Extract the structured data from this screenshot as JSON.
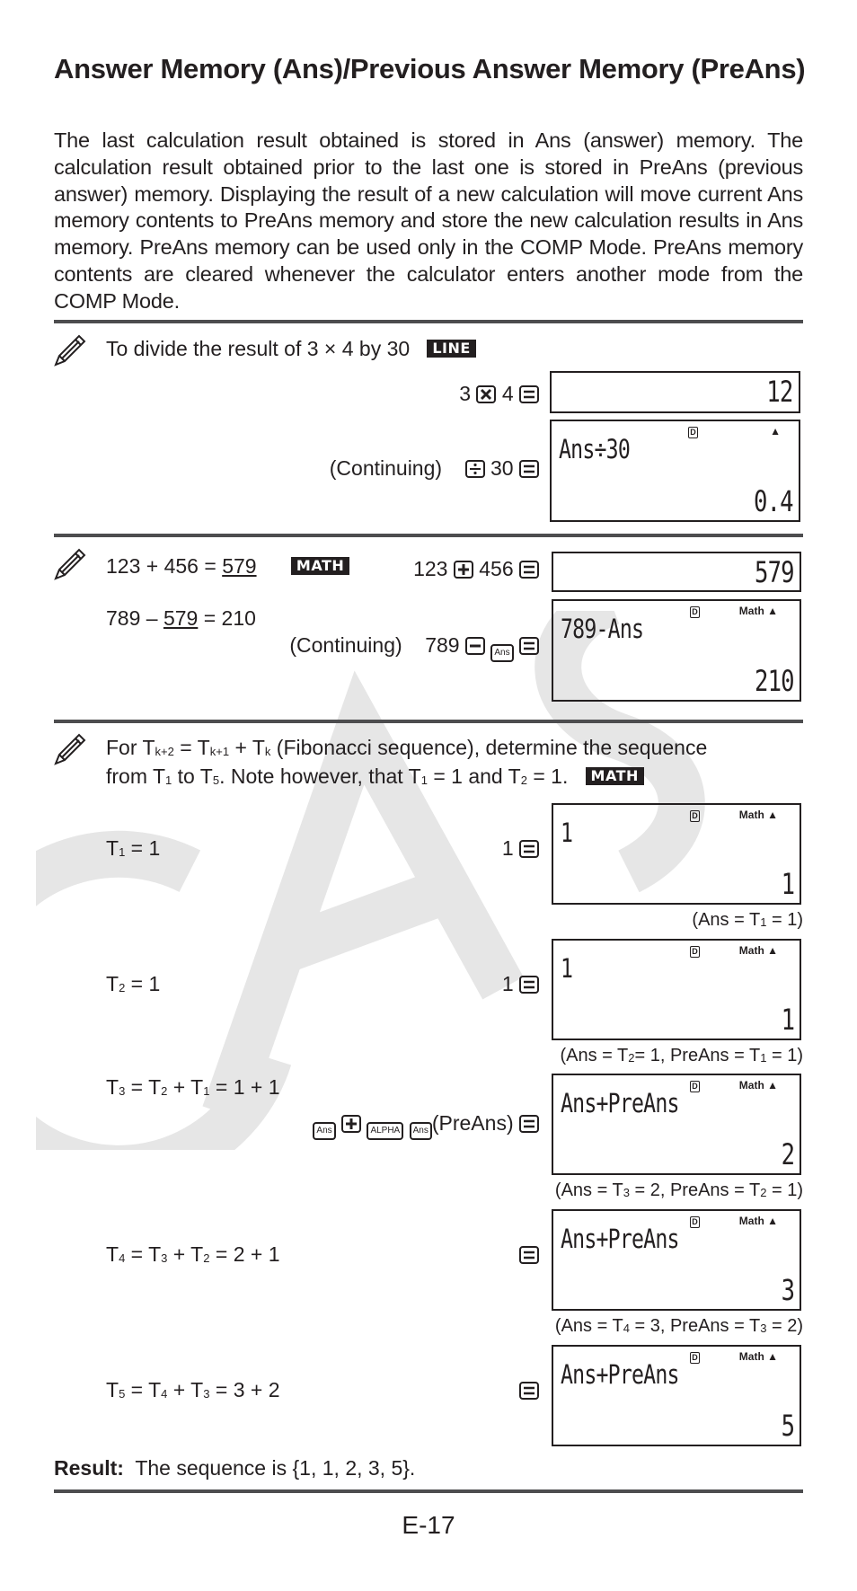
{
  "page": {
    "title": "Answer Memory (Ans)/Previous Answer Memory (PreAns)",
    "intro": "The last calculation result obtained is stored in Ans (answer) memory.  The calculation result obtained prior to the last one is stored in PreAns (previous answer) memory. Displaying the result of a new calculation will move current Ans memory contents to PreAns memory and store the new calculation results in Ans memory. PreAns memory can be used only in the COMP Mode. PreAns memory contents are cleared whenever the calculator enters another mode from the COMP Mode.",
    "page_number": "E-17",
    "watermark": "CASIO"
  },
  "example1": {
    "description": "To divide the result of 3 × 4 by 30",
    "mode_badge": "LINE",
    "step1": {
      "keys": [
        "3",
        "×",
        "4",
        "="
      ],
      "display_result": "12"
    },
    "step2": {
      "label": "(Continuing)",
      "keys": [
        "÷",
        "30",
        "="
      ],
      "display_expr": "Ans÷30",
      "display_result": "0.4",
      "indicators": [
        "D",
        "▲"
      ]
    }
  },
  "example2": {
    "line1": {
      "pre": "123 + 456 = ",
      "underlined": "579"
    },
    "mode_badge": "MATH",
    "line2": {
      "pre": "789 – ",
      "underlined": "579",
      "post": " = 210"
    },
    "step1": {
      "keys": [
        "123",
        "+",
        "456",
        "="
      ],
      "display_result": "579"
    },
    "step2": {
      "label": "(Continuing)",
      "keys": [
        "789",
        "−",
        "Ans",
        "="
      ],
      "display_expr": "789-Ans",
      "display_result": "210",
      "indicators": [
        "D",
        "Math",
        "▲"
      ]
    }
  },
  "example3": {
    "description_line1": "For T(k+2) = T(k+1) + T(k) (Fibonacci sequence), determine the sequence",
    "description_line2": "from T1 to T5. Note however, that T1 = 1 and T2 = 1.",
    "mode_badge": "MATH",
    "indicator_d": "D",
    "indicator_math": "Math ▲",
    "steps": [
      {
        "equation": "T1 = 1",
        "keys": [
          "1",
          "="
        ],
        "display_expr": "1",
        "display_result": "1",
        "note": "(Ans = T1 = 1)"
      },
      {
        "equation": "T2 = 1",
        "keys": [
          "1",
          "="
        ],
        "display_expr": "1",
        "display_result": "1",
        "note": "(Ans = T2 = 1, PreAns = T1 = 1)"
      },
      {
        "equation": "T3 = T2 + T1 = 1 + 1",
        "keys": [
          "Ans",
          "+",
          "ALPHA",
          "Ans",
          "(PreAns)",
          "="
        ],
        "display_expr": "Ans+PreAns",
        "display_result": "2",
        "note": "(Ans = T3 = 2, PreAns = T2 = 1)"
      },
      {
        "equation": "T4 = T3 + T2 = 2 + 1",
        "keys": [
          "="
        ],
        "display_expr": "Ans+PreAns",
        "display_result": "3",
        "note": "(Ans = T4 = 3, PreAns = T3 = 2)"
      },
      {
        "equation": "T5 = T4 + T3 = 3 + 2",
        "keys": [
          "="
        ],
        "display_expr": "Ans+PreAns",
        "display_result": "5"
      }
    ],
    "result_label": "Result:",
    "result_text": "The sequence is {1, 1, 2, 3, 5}."
  },
  "text": {
    "n3": "3",
    "n4": "4",
    "n30": "30",
    "n123": "123",
    "n456": "456",
    "n789": "789",
    "n1": "1",
    "sep_eq": " = ",
    "plus": " + ",
    "preans_paren": "(PreAns)",
    "ans_key": "Ans",
    "alpha_key": "ALPHA",
    "T": "T",
    "sub_k2": "k+2",
    "sub_k1": "k+1",
    "sub_k": "k",
    "fib_mid": " (Fibonacci sequence), determine the sequence",
    "from": "from T",
    "to": " to T",
    "note_however": ". Note however, that T",
    "eq1and": " = 1 and T",
    "eq1dot": " = 1."
  }
}
